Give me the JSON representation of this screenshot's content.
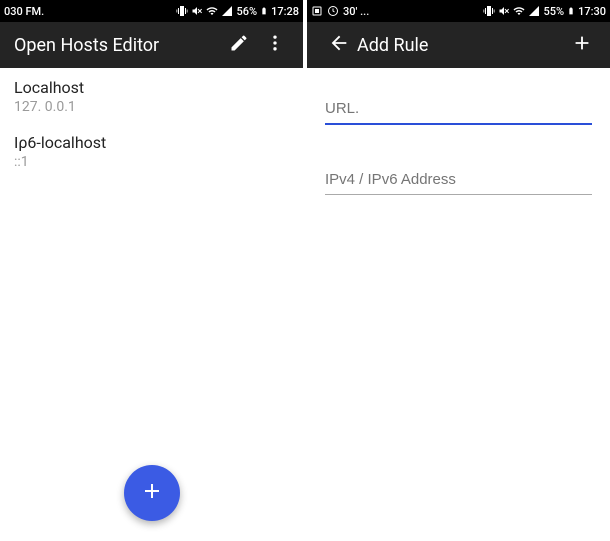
{
  "left": {
    "statusbar": {
      "left_text": "030 FM.",
      "battery_text": "56%",
      "time": "17:28"
    },
    "appbar": {
      "title": "Open Hosts Editor"
    },
    "hosts": [
      {
        "name": "Localhost",
        "ip": "127. 0.0.1"
      },
      {
        "name": "Iρ6-localhost",
        "ip": "::1"
      }
    ]
  },
  "right": {
    "statusbar": {
      "left_text": "30' ...",
      "battery_text": "55%",
      "time": "17:30"
    },
    "appbar": {
      "title": "Add Rule"
    },
    "form": {
      "url_label": "URL.",
      "addr_label": "IPv4 / IPv6 Address"
    }
  }
}
